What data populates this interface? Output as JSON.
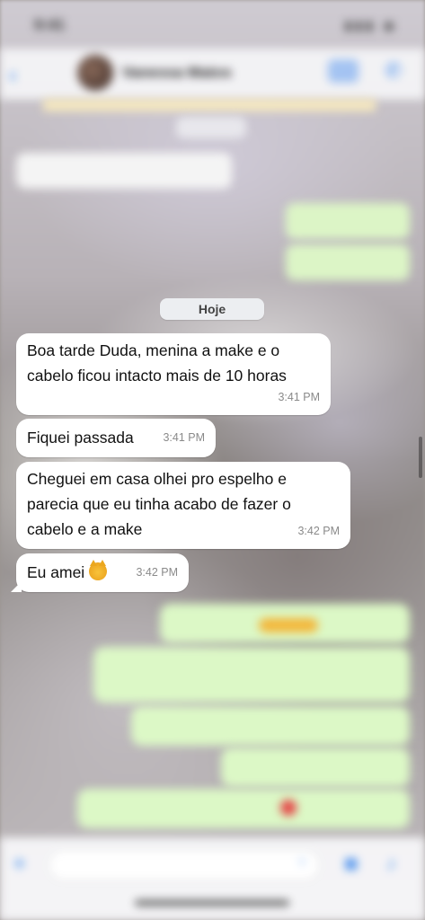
{
  "status_bar": {
    "time": "9:41"
  },
  "header": {
    "contact_name": "Vanessa Matos",
    "unread_count": ""
  },
  "date_separator": "Hoje",
  "messages": [
    {
      "direction": "in",
      "text": "Boa tarde Duda, menina a make e o cabelo ficou intacto mais de 10 horas",
      "time": "3:41 PM"
    },
    {
      "direction": "in",
      "text": "Fiquei passada",
      "time": "3:41 PM"
    },
    {
      "direction": "in",
      "text": "Cheguei em casa olhei pro espelho e parecia que eu tinha acabo de fazer o cabelo e a make",
      "time": "3:42 PM"
    },
    {
      "direction": "in",
      "text": "Eu amei",
      "emoji": "heart-eyes-cat",
      "time": "3:42 PM"
    }
  ],
  "colors": {
    "incoming": "#ffffff",
    "outgoing": "#dcf8c6",
    "accent": "#2f80ed"
  },
  "icons": [
    "back-icon",
    "video-icon",
    "phone-icon",
    "plus-icon",
    "sticker-icon",
    "camera-icon",
    "mic-icon"
  ]
}
